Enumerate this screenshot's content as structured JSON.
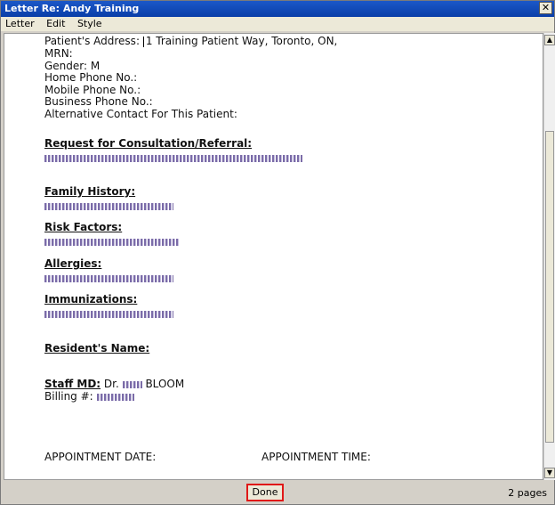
{
  "window": {
    "title": "Letter Re: Andy Training",
    "close_glyph": "✕"
  },
  "menu": {
    "items": [
      "Letter",
      "Edit",
      "Style"
    ]
  },
  "document": {
    "patient_address_label": "Patient's Address:",
    "patient_address_value": "1 Training Patient Way, Toronto, ON,",
    "mrn": "MRN:",
    "gender": "Gender: M",
    "home_phone": "Home Phone No.:",
    "mobile_phone": "Mobile Phone No.:",
    "business_phone": "Business Phone No.:",
    "alt_contact": "Alternative Contact For This Patient:",
    "request_heading": "Request for Consultation/Referral:",
    "family_heading": "Family History:",
    "risk_heading": "Risk Factors:",
    "allergies_heading": "Allergies:",
    "immunizations_heading": "Immunizations:",
    "resident_heading": "Resident's Name:",
    "staff_md_label": "Staff MD:",
    "staff_md_prefix": "Dr.",
    "staff_md_surname": "BLOOM",
    "billing_label": "Billing #:",
    "appt_date": "APPOINTMENT DATE:",
    "appt_time": "APPOINTMENT TIME:"
  },
  "status": {
    "done_label": "Done",
    "pages": "2 pages"
  }
}
